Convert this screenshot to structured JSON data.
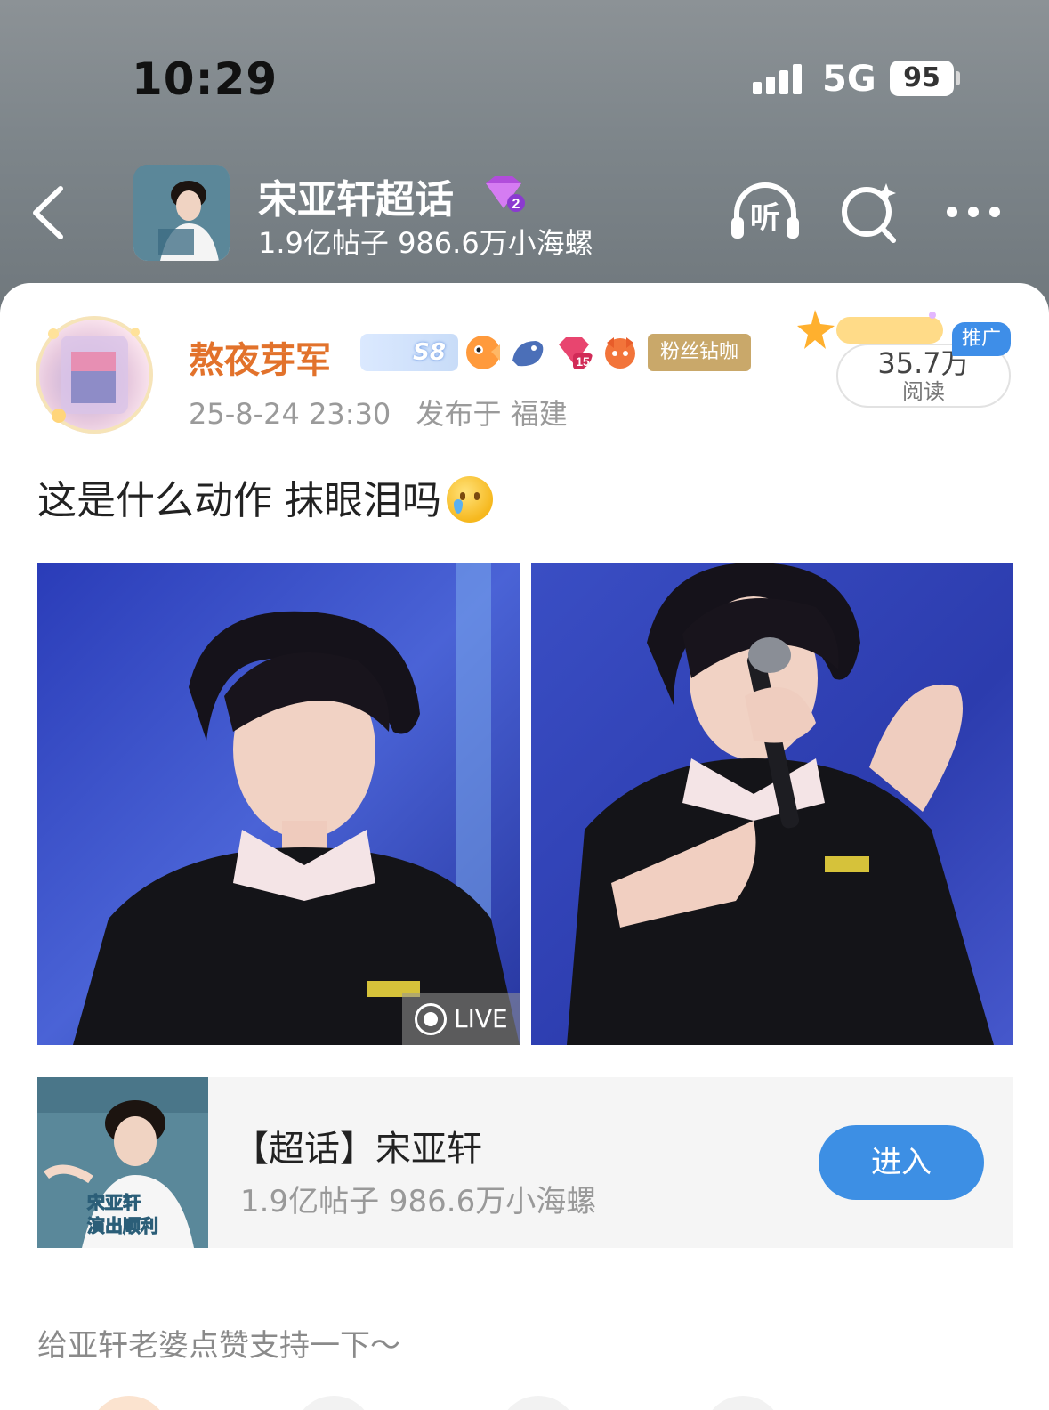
{
  "status_bar": {
    "time": "10:29",
    "network": "5G",
    "battery": "95"
  },
  "nav": {
    "title": "宋亚轩超话",
    "subtitle": "1.9亿帖子 986.6万小海螺",
    "badge_level": "2",
    "listen_label": "听"
  },
  "post": {
    "author": "熬夜芽军",
    "level_badge": "S8",
    "fan_badge": "粉丝钻咖",
    "gift_level": "15",
    "time": "25-8-24 23:30",
    "location": "发布于 福建",
    "reads": "35.7万",
    "reads_label": "阅读",
    "promo_tag": "推广",
    "text": "这是什么动作 抹眼泪吗",
    "live_label": "LIVE"
  },
  "topic_card": {
    "title": "【超话】宋亚轩",
    "stats": "1.9亿帖子 986.6万小海螺",
    "enter_label": "进入",
    "cover_text_1": "宋亚轩",
    "cover_text_2": "演出顺利"
  },
  "footer": {
    "prompt": "给亚轩老婆点赞支持一下～"
  },
  "colors": {
    "accent_blue": "#3d8fe4",
    "username_orange": "#e2722b",
    "header_gray": "#7d858a"
  },
  "icons": [
    "back-icon",
    "headphone-icon",
    "search-icon",
    "more-icon",
    "live-icon"
  ]
}
